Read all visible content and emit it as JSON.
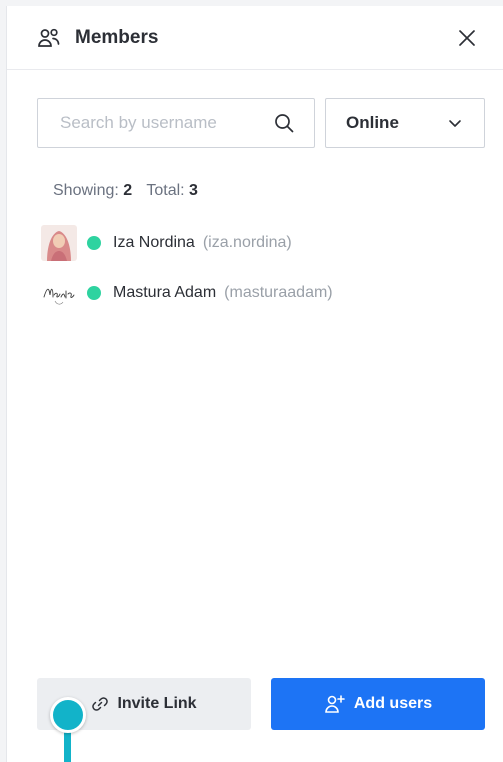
{
  "header": {
    "title": "Members",
    "icon": "members-icon",
    "close_icon": "close-icon"
  },
  "search": {
    "placeholder": "Search by username",
    "value": "",
    "icon": "search-icon"
  },
  "status_filter": {
    "selected": "Online",
    "icon": "chevron-down-icon"
  },
  "counts": {
    "showing_label": "Showing:",
    "showing": "2",
    "total_label": "Total:",
    "total": "3"
  },
  "members": [
    {
      "name": "Iza Nordina",
      "username": "(iza.nordina)",
      "status": "online",
      "status_color": "#2ed3a0"
    },
    {
      "name": "Mastura Adam",
      "username": "(masturaadam)",
      "status": "online",
      "status_color": "#2ed3a0",
      "avatar_text": "Mastura"
    }
  ],
  "footer": {
    "invite_label": "Invite Link",
    "invite_icon": "link-icon",
    "add_label": "Add users",
    "add_icon": "add-user-icon"
  },
  "colors": {
    "accent": "#1d74f5",
    "online": "#2ed3a0",
    "cursor": "#12b3c9"
  }
}
